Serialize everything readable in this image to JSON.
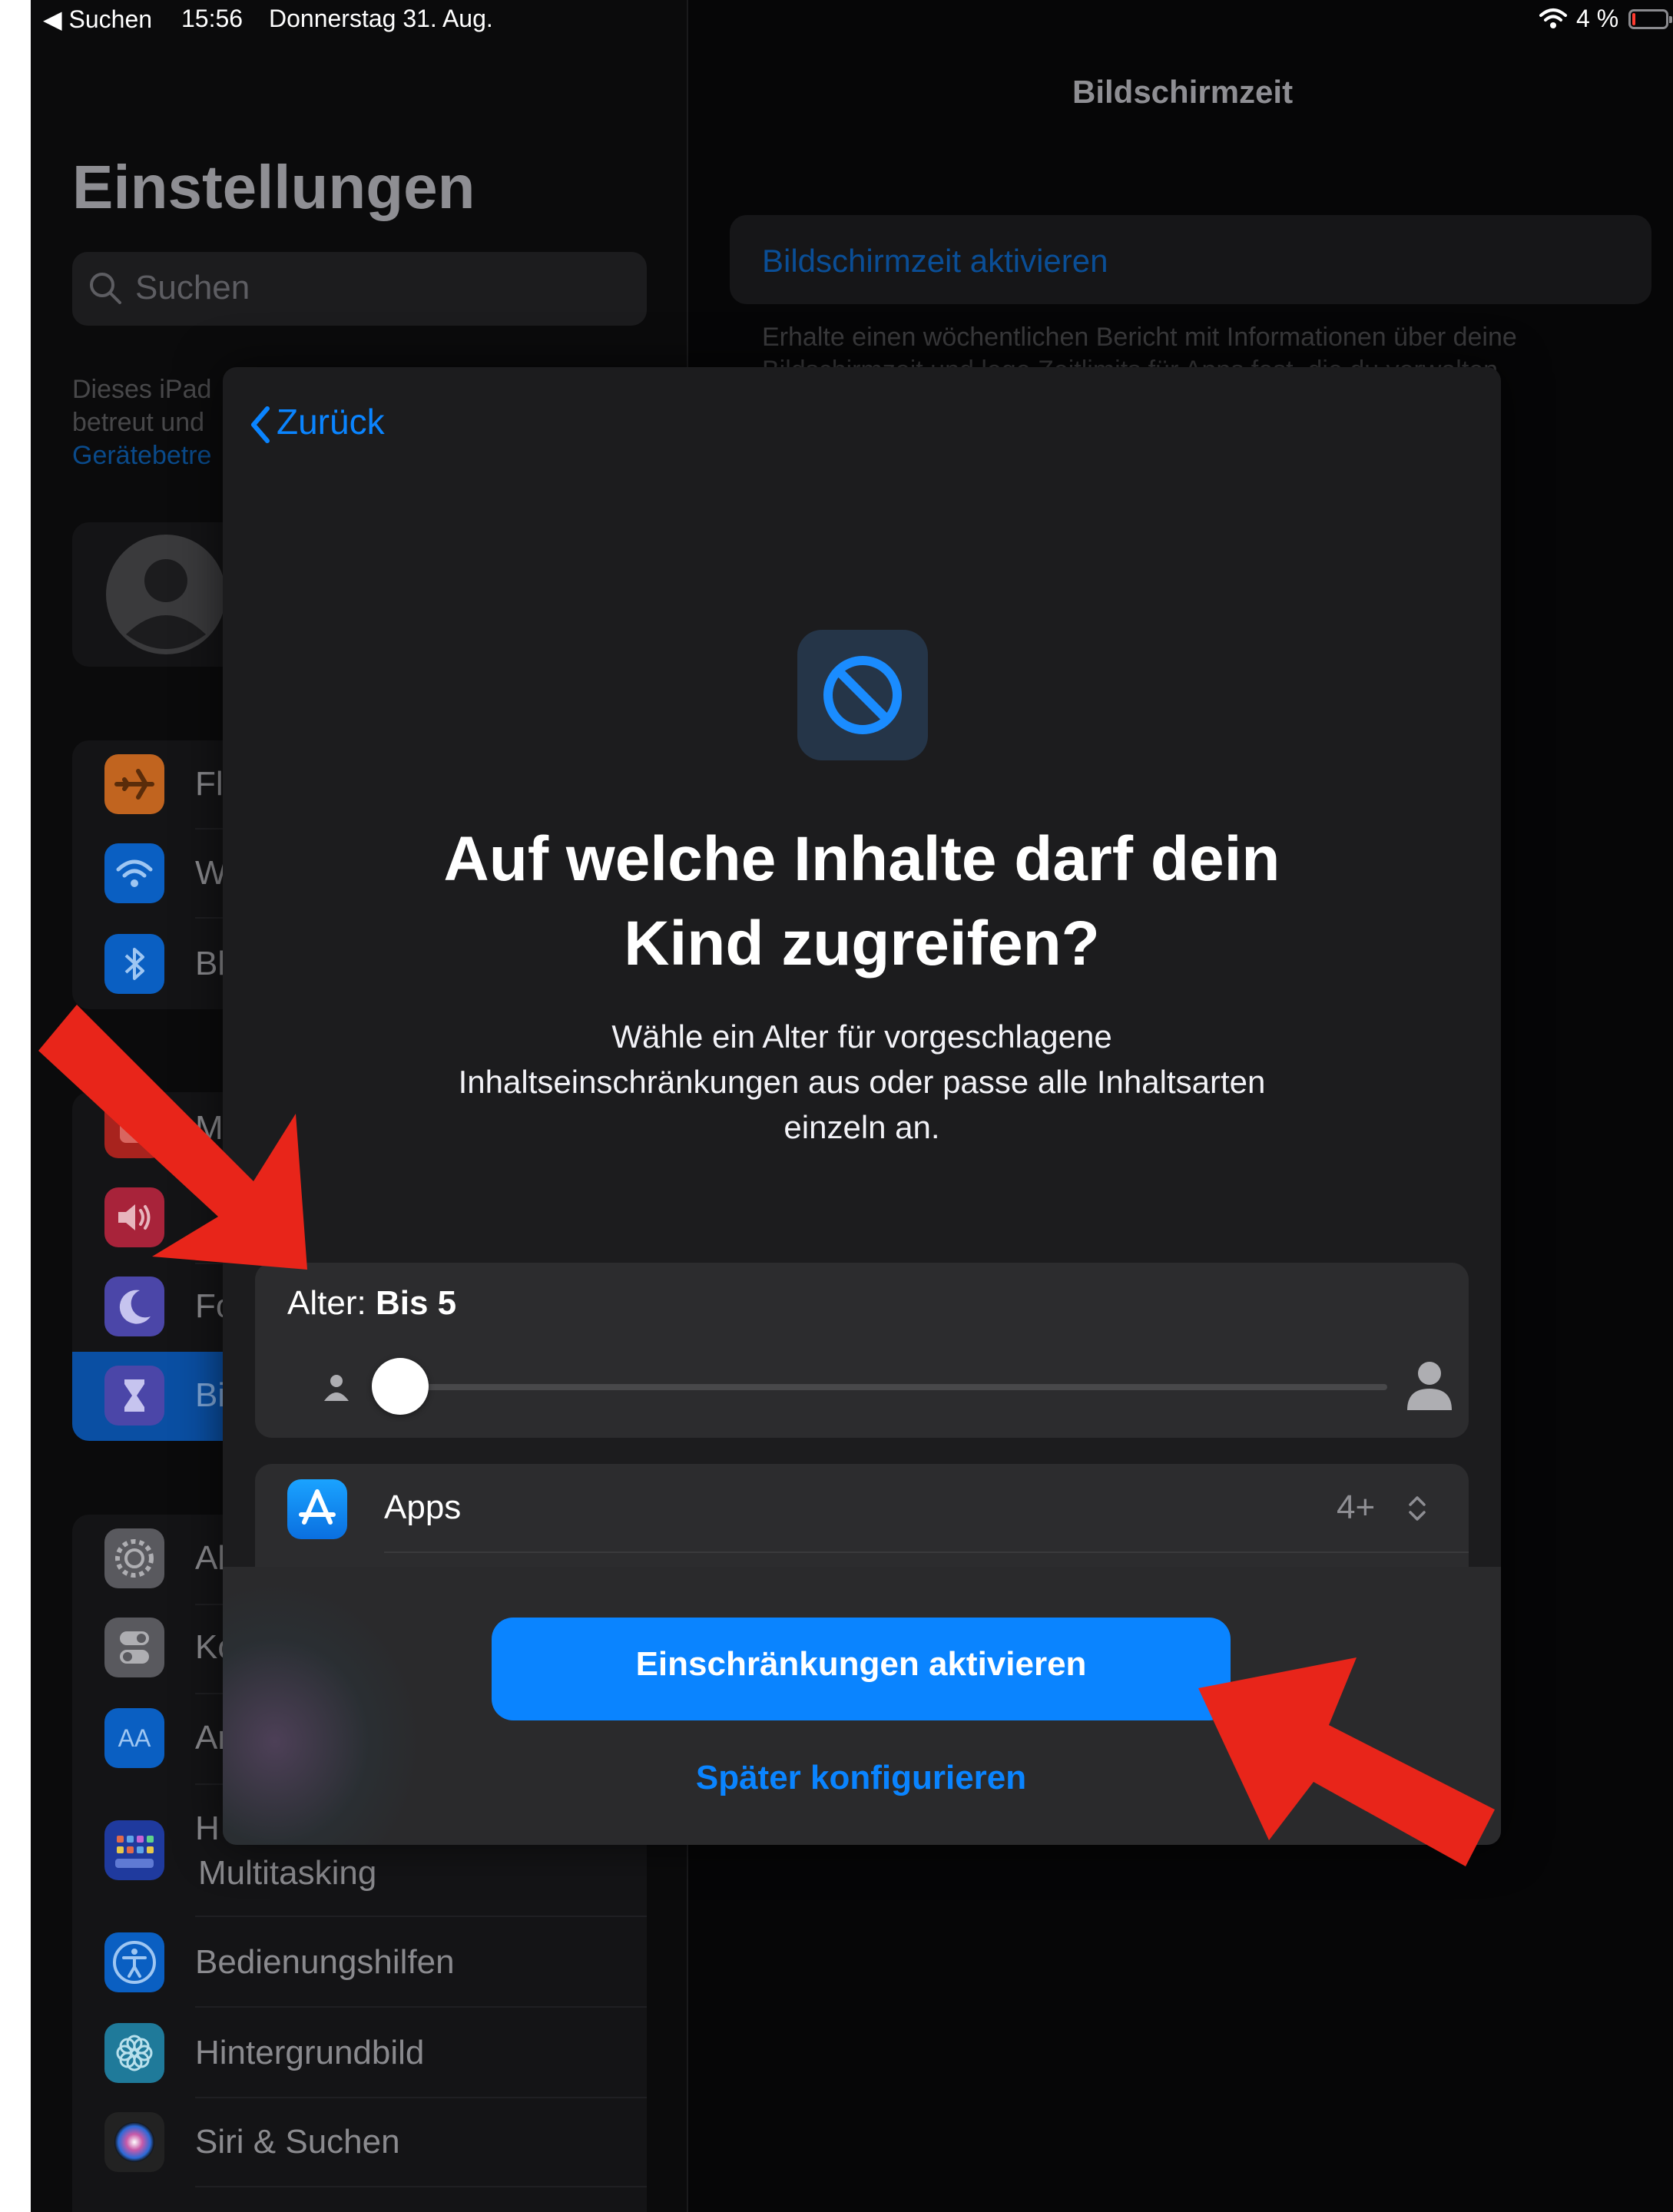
{
  "status_bar": {
    "back_app": "◀ Suchen",
    "time": "15:56",
    "date": "Donnerstag 31. Aug.",
    "battery": "4 %"
  },
  "sidebar": {
    "title": "Einstellungen",
    "search_placeholder": "Suchen",
    "note_line1": "Dieses iPad",
    "note_line2": "betreut und",
    "note_link": "Gerätebetre",
    "rows_group1": [
      {
        "label": "Fl",
        "icon": "airplane-icon",
        "color": "#c1641f"
      },
      {
        "label": "W",
        "icon": "wifi-icon",
        "color": "#0a5fc2"
      },
      {
        "label": "Bl",
        "icon": "bluetooth-icon",
        "color": "#0a5fc2"
      }
    ],
    "rows_group2": [
      {
        "label": "M",
        "icon": "notifications-icon",
        "color": "#a8231e"
      },
      {
        "label": "",
        "icon": "sound-icon",
        "color": "#a8233a"
      },
      {
        "label": "Fo",
        "icon": "moon-icon",
        "color": "#4b46a8"
      },
      {
        "label": "Bi",
        "icon": "hourglass-icon",
        "color": "#4b46a8"
      }
    ],
    "rows_group3": [
      {
        "label": "Al",
        "icon": "gear-icon",
        "color": "#59595e"
      },
      {
        "label": "Ko",
        "icon": "toggles-icon",
        "color": "#59595e"
      },
      {
        "label": "Ar",
        "icon": "text-size-icon",
        "color": "#0a5fc2"
      },
      {
        "label": "H",
        "label2": "Multitasking",
        "icon": "home-screen-icon",
        "color": "#1f3a9e"
      },
      {
        "label": "Bedienungshilfen",
        "icon": "accessibility-icon",
        "color": "#0a5fc2"
      },
      {
        "label": "Hintergrundbild",
        "icon": "flower-icon",
        "color": "#1f7a9a"
      },
      {
        "label": "Siri & Suchen",
        "icon": "siri-icon",
        "color": "#222"
      }
    ]
  },
  "detail": {
    "title": "Bildschirmzeit",
    "activate_link": "Bildschirmzeit aktivieren",
    "footer_line1": "Erhalte einen wöchentlichen Bericht mit Informationen über deine",
    "footer_line2": "Bildschirmzeit und lege Zeitlimits für Apps fest, die du verwalten"
  },
  "modal": {
    "back_label": "Zurück",
    "icon": "restriction-icon",
    "headline_line1": "Auf welche Inhalte darf dein",
    "headline_line2": "Kind zugreifen?",
    "subtitle_line1": "Wähle ein Alter für vorgeschlagene",
    "subtitle_line2": "Inhaltseinschränkungen aus oder passe alle Inhaltsarten",
    "subtitle_line3": "einzeln an.",
    "age_label": "Alter:",
    "age_value": "Bis 5",
    "slider_fraction": 0,
    "apps_label": "Apps",
    "apps_value": "4+",
    "primary_button": "Einschränkungen aktivieren",
    "secondary_button": "Später konfigurieren"
  },
  "colors": {
    "accent": "#0a84ff",
    "annotation_arrow": "#e8251a"
  }
}
